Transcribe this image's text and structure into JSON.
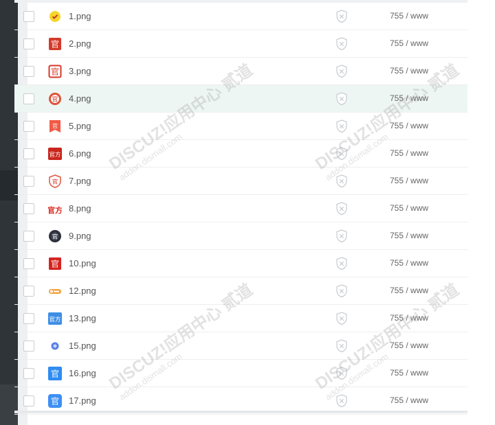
{
  "files": [
    {
      "name": "1.png",
      "perm": "755 / www",
      "icon": "yellow-check-badge-icon"
    },
    {
      "name": "2.png",
      "perm": "755 / www",
      "icon": "red-guan-seal-icon"
    },
    {
      "name": "3.png",
      "perm": "755 / www",
      "icon": "red-guan-outline-icon"
    },
    {
      "name": "4.png",
      "perm": "755 / www",
      "icon": "red-guan-round-badge-icon"
    },
    {
      "name": "5.png",
      "perm": "755 / www",
      "icon": "red-ribbon-badge-icon"
    },
    {
      "name": "6.png",
      "perm": "755 / www",
      "icon": "red-guanfang-badge-icon"
    },
    {
      "name": "7.png",
      "perm": "755 / www",
      "icon": "red-guan-shield-icon"
    },
    {
      "name": "8.png",
      "perm": "755 / www",
      "icon": "red-guanfang-text-icon"
    },
    {
      "name": "9.png",
      "perm": "755 / www",
      "icon": "dark-guan-round-badge-icon"
    },
    {
      "name": "10.png",
      "perm": "755 / www",
      "icon": "red-guan-square-icon"
    },
    {
      "name": "12.png",
      "perm": "755 / www",
      "icon": "orange-pill-badge-icon"
    },
    {
      "name": "13.png",
      "perm": "755 / www",
      "icon": "blue-guanfang-badge-icon"
    },
    {
      "name": "15.png",
      "perm": "755 / www",
      "icon": "blue-dot-badge-icon"
    },
    {
      "name": "16.png",
      "perm": "755 / www",
      "icon": "blue-guan-square-icon"
    },
    {
      "name": "17.png",
      "perm": "755 / www",
      "icon": "blue-guan-rounded-icon"
    }
  ],
  "watermark": {
    "brand": "DISCUZ!应用中心",
    "brand2": "贰道",
    "site": "addon.dismall.com"
  },
  "colors": {
    "highlight_row": "#eef6f3",
    "sidebar_dark": "#2f3438"
  }
}
